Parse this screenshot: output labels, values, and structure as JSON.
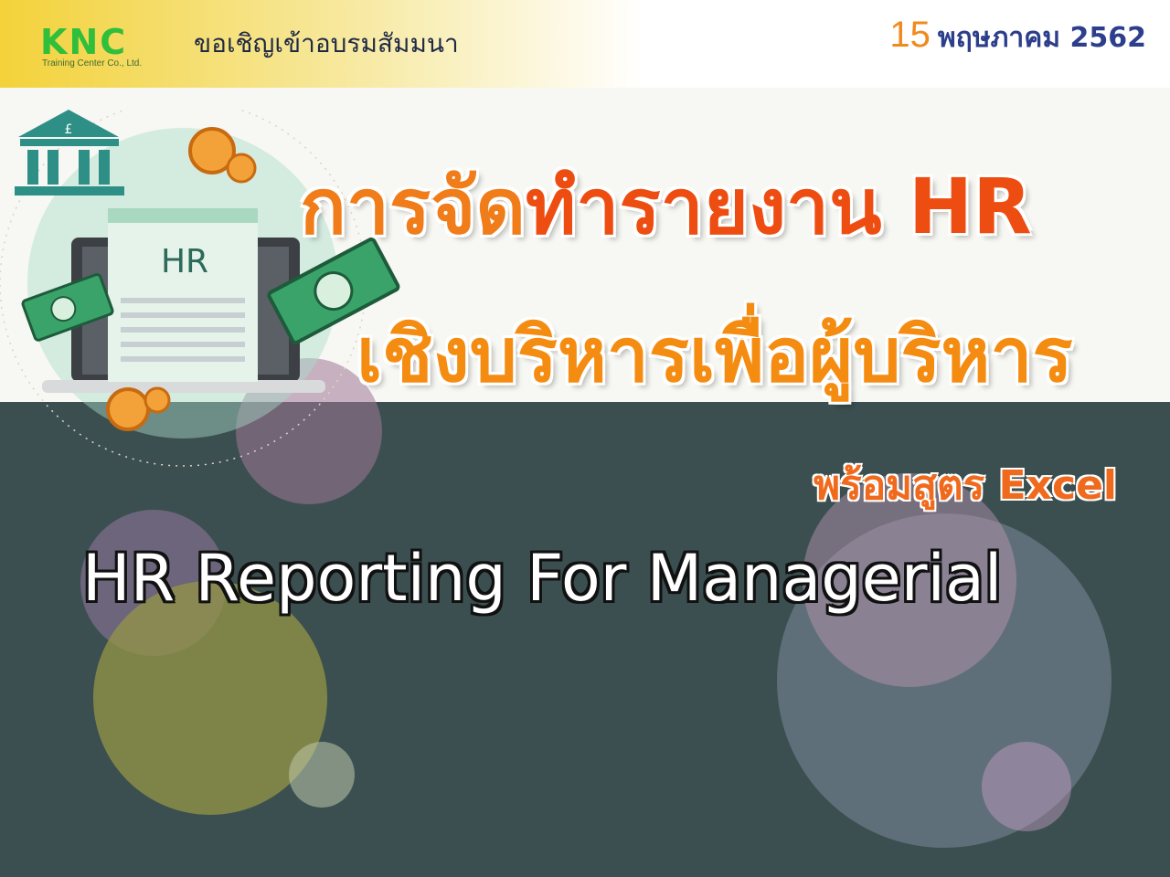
{
  "header": {
    "logo_text": "KNC",
    "logo_subtitle": "Training Center Co., Ltd.",
    "invite_text": "ขอเชิญเข้าอบรมสัมมนา",
    "date_day": "15",
    "date_rest": "พฤษภาคม 2562"
  },
  "title": {
    "line1_part1": "การจัด",
    "line1_part2": "ทำรายงาน HR",
    "line2": "เชิงบริหารเพื่อผู้บริหาร",
    "line3": "พร้อมสูตร Excel",
    "english": "HR Reporting For Managerial"
  },
  "illustration": {
    "document_label": "HR",
    "coin_symbol": "£",
    "icons": [
      "bank-icon",
      "laptop-icon",
      "document-icon",
      "banknote-icon",
      "coin-icon"
    ]
  },
  "colors": {
    "dark_bg": "#3b4f50",
    "title_orange": "#f07d1a",
    "title_red": "#ee4d12",
    "logo_green": "#2fbf3a"
  }
}
